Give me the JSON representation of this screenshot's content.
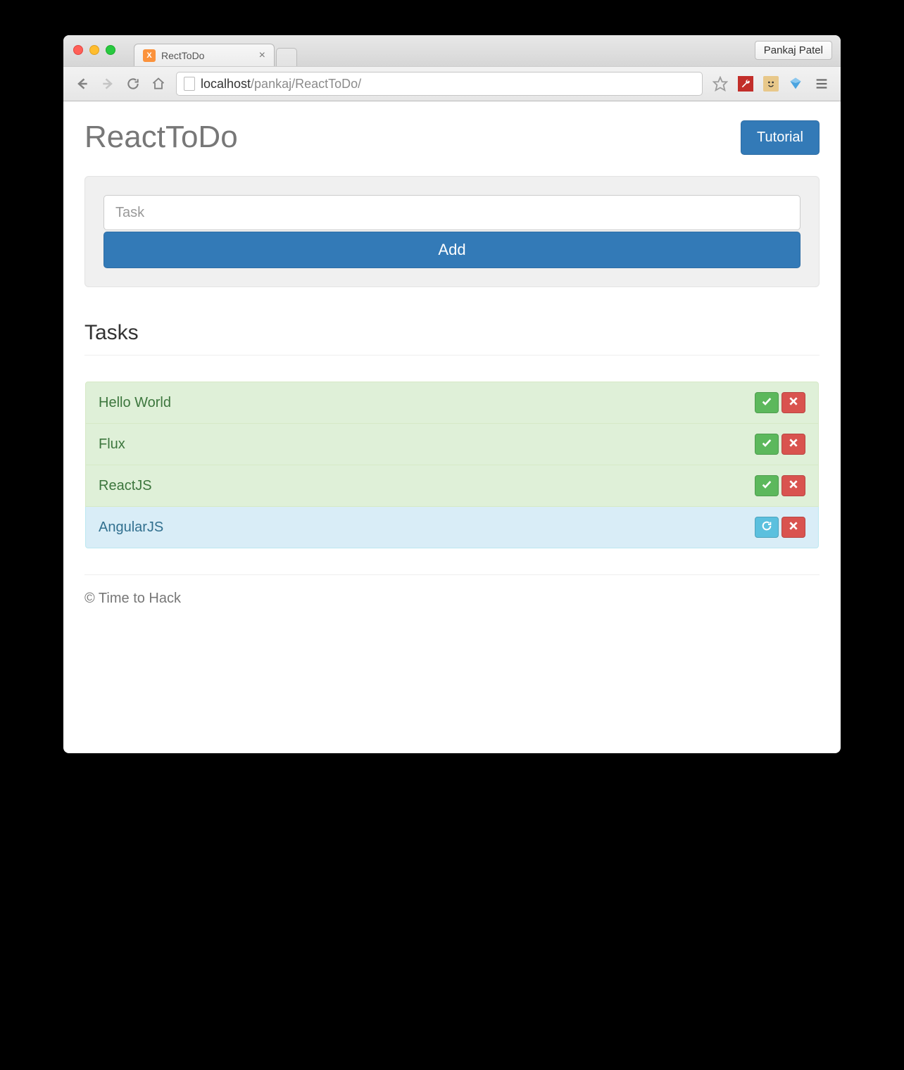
{
  "browser": {
    "tab_title": "RectToDo",
    "user_chip": "Pankaj Patel",
    "url_host": "localhost",
    "url_path": "/pankaj/ReactToDo/"
  },
  "header": {
    "title": "ReactToDo",
    "tutorial_button": "Tutorial"
  },
  "form": {
    "task_placeholder": "Task",
    "add_button": "Add"
  },
  "tasks": {
    "heading": "Tasks",
    "items": [
      {
        "text": "Hello World",
        "status": "success",
        "primary_action": "check"
      },
      {
        "text": "Flux",
        "status": "success",
        "primary_action": "check"
      },
      {
        "text": "ReactJS",
        "status": "success",
        "primary_action": "check"
      },
      {
        "text": "AngularJS",
        "status": "info",
        "primary_action": "refresh"
      }
    ]
  },
  "footer": {
    "text": "© Time to Hack"
  },
  "colors": {
    "primary": "#337ab7",
    "success_bg": "#dff0d8",
    "info_bg": "#d9edf7",
    "danger": "#d9534f",
    "success_btn": "#5cb85c",
    "info_btn": "#5bc0de"
  }
}
